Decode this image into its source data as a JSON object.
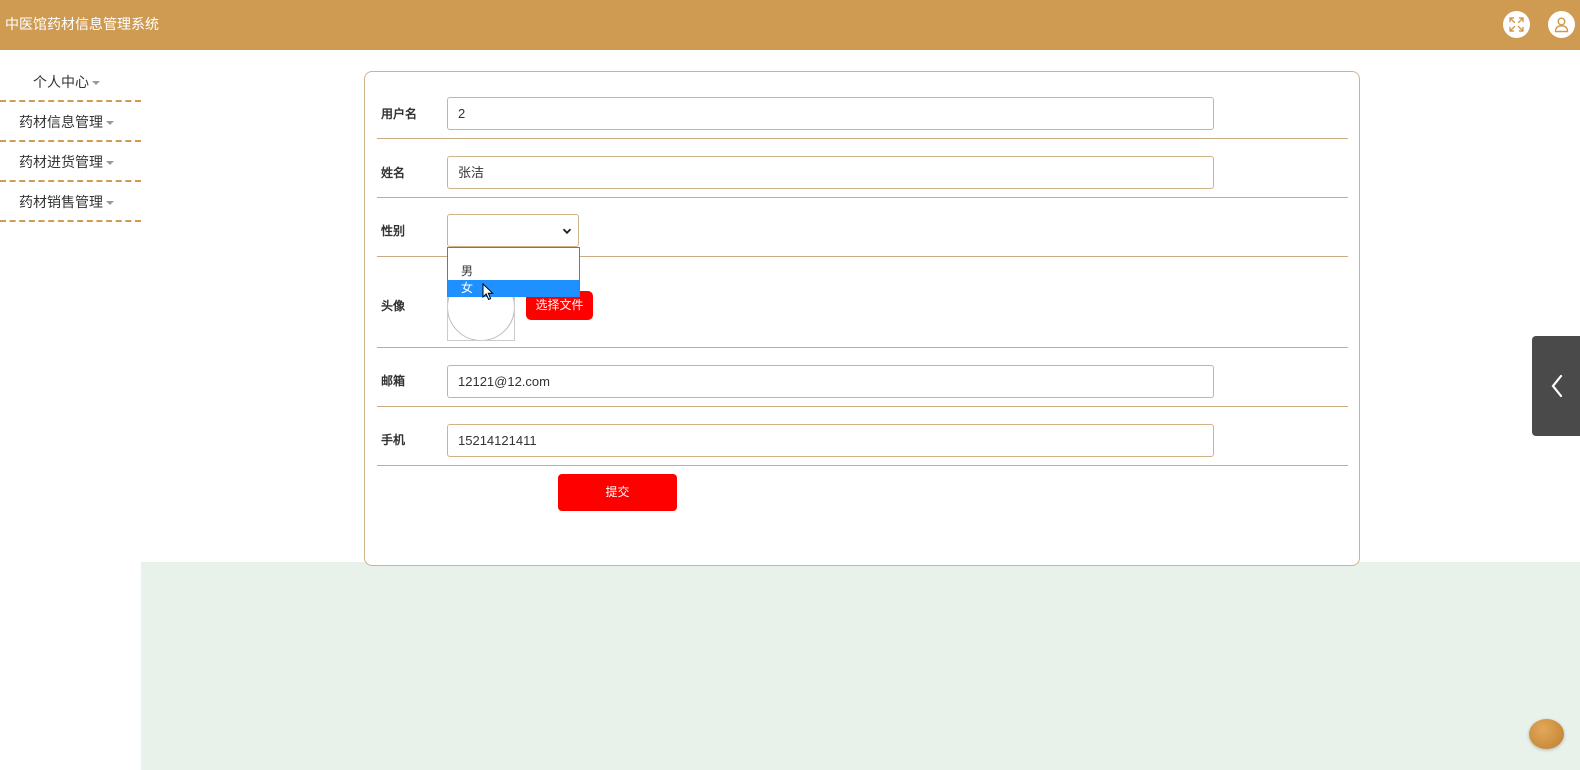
{
  "app": {
    "title": "中医馆药材信息管理系统"
  },
  "header": {
    "fullscreen_icon": "expand-arrows-icon",
    "user_icon": "user-icon"
  },
  "sidebar": {
    "items": [
      {
        "label": "个人中心"
      },
      {
        "label": "药材信息管理"
      },
      {
        "label": "药材进货管理"
      },
      {
        "label": "药材销售管理"
      }
    ]
  },
  "form": {
    "username": {
      "label": "用户名",
      "value": "2"
    },
    "name": {
      "label": "姓名",
      "value": "张洁"
    },
    "gender": {
      "label": "性别",
      "value": "",
      "options": [
        "男",
        "女"
      ],
      "highlighted": "女"
    },
    "avatar": {
      "label": "头像",
      "button": "选择文件"
    },
    "email": {
      "label": "邮箱",
      "value": "12121@12.com"
    },
    "phone": {
      "label": "手机",
      "value": "15214121411"
    },
    "submit_label": "提交"
  },
  "colors": {
    "header": "#cf9a52",
    "accent_button": "#ff0000",
    "highlight": "#1e90ff",
    "content_bg": "#e8f1ea"
  }
}
